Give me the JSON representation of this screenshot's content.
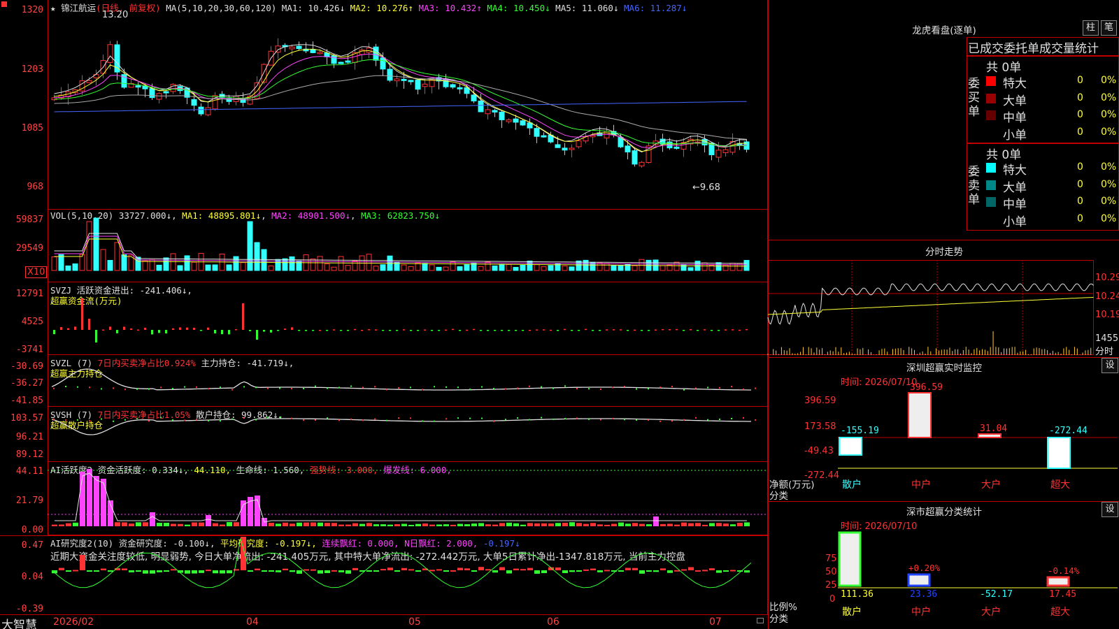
{
  "stock_name": "锦江航运",
  "period_label": "(日线, 前复权)",
  "ma_main": {
    "prefix": "MA(5,10,20,30,60,120)",
    "items": [
      {
        "label": "MA1: 10.426↓",
        "color": "#e0e0e0"
      },
      {
        "label": "MA2: 10.276↑",
        "color": "#ffff33"
      },
      {
        "label": "MA3: 10.432↑",
        "color": "#ff44ff"
      },
      {
        "label": "MA4: 10.450↓",
        "color": "#33ff33"
      },
      {
        "label": "MA5: 11.060↓",
        "color": "#e0e0e0"
      },
      {
        "label": "MA6: 11.287↓",
        "color": "#4466ff"
      }
    ]
  },
  "price_axis": [
    "1320",
    "1203",
    "1085",
    "968"
  ],
  "price_high_note": "13.20",
  "price_low_note": "←9.68",
  "vol": {
    "prefix": "VOL(5,10,20)",
    "value": "33727.000↓",
    "ma1": "MA1: 48895.801↓",
    "ma2": "MA2: 48901.500↓",
    "ma3": "MA3: 62823.750↓",
    "axis": [
      "59837",
      "29549"
    ],
    "unit": "X10"
  },
  "svzj": {
    "title": "SVZJ  活跃资金进出: -241.406↓,",
    "subtitle": "超赢资金流(万元)",
    "axis": [
      "12791",
      "4525",
      "-3741"
    ]
  },
  "svzl": {
    "prefix": "SVZL (7)",
    "t1": "7日内买卖净占比0.924%",
    "t2": "主力持仓: -41.719↓,",
    "subtitle": "超赢主力持仓",
    "axis": [
      "-30.69",
      "-36.27",
      "-41.85"
    ]
  },
  "svsh": {
    "prefix": "SVSH (7)",
    "t1": "7日内买卖净占比1.05%",
    "t2": "散户持仓: 99.862↓,",
    "subtitle": "超赢散户持仓",
    "axis": [
      "103.57",
      "96.21",
      "89.12"
    ]
  },
  "ai_act": {
    "prefix": "AI活跃度2",
    "t1": "资金活跃度: 0.334↓,",
    "t2": "44.110,",
    "t3": "生命线: 1.560,",
    "t4": "强势线: 3.000,",
    "t5": "爆发线: 6.000,",
    "axis": [
      "44.11",
      "21.79",
      "0.00"
    ]
  },
  "ai_res": {
    "prefix": "AI研究度2(10)",
    "t1": "资金研究度: -0.100↓,",
    "t2": "平均研究度: -0.197↓,",
    "t3": "连续飘红: 0.000,",
    "t4": "N日飘红: 2.000,",
    "t5": "-0.197↓",
    "comment": "近期大资金关注度较低, 明显弱势, 今日大单净流出: -241.405万元, 其中特大单净流出: -272.442万元, 大单5日累计净出-1347.818万元, 当前主力控盘",
    "axis": [
      "0.47",
      "0.04",
      "-0.39"
    ]
  },
  "xaxis": [
    "2026/02",
    "04",
    "05",
    "06",
    "07"
  ],
  "brand": "大智慧",
  "right": {
    "lhb_title": "龙虎看盘(逐单)",
    "btn_zhu": "柱",
    "btn_bi": "笔",
    "tab_header": "已成交委托单成交量统计",
    "buy_side": "委买单",
    "sell_side": "委卖单",
    "buy_total": "共 0单",
    "sell_total": "共 0单",
    "rows": [
      {
        "label": "特大",
        "val": "0",
        "pct": "0%"
      },
      {
        "label": "大单",
        "val": "0",
        "pct": "0%"
      },
      {
        "label": "中单",
        "val": "0",
        "pct": "0%"
      },
      {
        "label": "小单",
        "val": "0",
        "pct": "0%"
      }
    ],
    "buy_colors": [
      "#ff0000",
      "#990000",
      "#660000",
      "#000000"
    ],
    "sell_colors": [
      "#00ffff",
      "#008888",
      "#006666",
      "#000000"
    ],
    "intraday_title": "分时走势",
    "intraday_axis": [
      "10.29",
      "10.24",
      "10.19"
    ],
    "intraday_vol": "1455",
    "intraday_unit": "分时",
    "monitor_title": "深圳超赢实时监控",
    "monitor_set": "设",
    "monitor_time": "时间: 2026/07/10",
    "monitor_axis": [
      "396.59",
      "173.58",
      "-49.43",
      "-272.44"
    ],
    "monitor_ylabel": "净额(万元)",
    "monitor_xlabel": "分类",
    "monitor_cats": [
      "散户",
      "中户",
      "大户",
      "超大"
    ],
    "monitor_vals": [
      "-155.19",
      "396.59",
      "31.04",
      "-272.44"
    ],
    "monitor_values_num": [
      -155.19,
      396.59,
      31.04,
      -272.44
    ],
    "class_title": "深市超赢分类统计",
    "class_set": "设",
    "class_time": "时间: 2026/07/10",
    "class_axis": [
      "75",
      "50",
      "25",
      "0"
    ],
    "class_ylabel": "比例%",
    "class_xlabel": "分类",
    "class_cats": [
      "散户",
      "中户",
      "大户",
      "超大"
    ],
    "class_vals": [
      "111.36",
      "23.36",
      "-52.17",
      "17.45"
    ],
    "class_pcts": [
      "+0.20%",
      "-0.14%"
    ]
  }
}
